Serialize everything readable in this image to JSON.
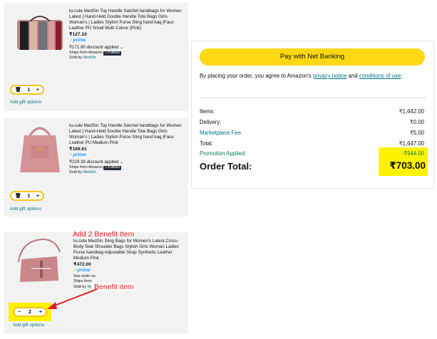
{
  "items": [
    {
      "title": "tu-cute MedSin Top Handle Satchel handbags for Women Latest | Hand-Held Double Handle Tote Bags Girls Woman's | Ladies Stylish Purse Sling hand bag |Faux Leather PU Small Multi Colour (Pink)",
      "price": "₹127.10",
      "prime": "prime",
      "discount": "₹171.90 discount applied",
      "ships": "Ships from Amazon",
      "fulfilled": "Fulfilled",
      "sold_by_label": "Sold by",
      "sold_by": "MedSin",
      "qty": "1",
      "gift": "Add gift options"
    },
    {
      "title": "tu-cute MedSin Top Handle Satchel handbags for Women Latest | Hand-Held Double Handle Tote Bags Girls Woman's | Ladies Stylish Purse Sling hand bag |Faux Leather PU Medium Pink",
      "price": "₹169.61",
      "prime": "prime",
      "discount": "₹229.39 discount applied",
      "ships": "Ships from Amazon",
      "fulfilled": "Fulfilled",
      "sold_by_label": "Sold by",
      "sold_by": "MedSin",
      "qty": "1",
      "gift": "Add gift options"
    },
    {
      "title": "tu-cute MedSin Sling Bags for Women's Latest Cross-Body Side Shoulder Bags Stylish Girls Woman Ladies Purse handbag Adjustable Strap Synthetic Leather Medium Pink",
      "price": "₹472.00",
      "prime": "prime",
      "discount": "See order su",
      "ships": "Ships from",
      "sold_by_label": "Sold by",
      "sold_by": "MedSin",
      "qty": "2",
      "gift": "Add gift options"
    }
  ],
  "annotations": {
    "top": "Add 2 Benefit Item",
    "bottom": "Benefit item"
  },
  "summary": {
    "pay_button": "Pay with Net Banking",
    "agree_prefix": "By placing your order, you agree to Amazon's ",
    "privacy_link": "privacy notice",
    "agree_and": " and ",
    "conditions_link": "conditions of use",
    "agree_suffix": ".",
    "rows": [
      {
        "label": "Items:",
        "value": "₹1,642.00"
      },
      {
        "label": "Delivery:",
        "value": "₹0.00"
      },
      {
        "label": "Marketplace Fee",
        "value": "₹5.00"
      },
      {
        "label": "Total:",
        "value": "₹1,647.00"
      },
      {
        "label": "Promotion Applied:",
        "value": "-₹944.00"
      }
    ],
    "order_total_label": "Order Total:",
    "order_total_value": "₹703.00"
  },
  "colors": {
    "highlight": "#fff200",
    "pay_button": "#ffd814",
    "annotation": "#e02020",
    "link": "#007185"
  }
}
